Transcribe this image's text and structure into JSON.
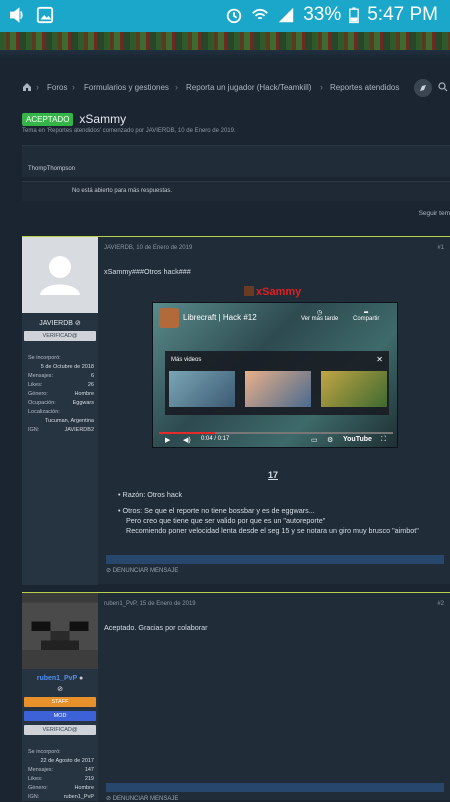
{
  "statusbar": {
    "battery": "33%",
    "time": "5:47 PM"
  },
  "colors": {
    "accent": "#1aa7c9",
    "badge": "#35b548",
    "staff": "#e8902a",
    "mod": "#3d62d8"
  },
  "breadcrumbs": [
    "Foros",
    "Formularios y gestiones",
    "Reporta un jugador (Hack/Teamkill)",
    "Reportes atendidos"
  ],
  "thread": {
    "badge": "ACEPTADO",
    "title": "xSammy",
    "meta": "Tema en 'Reportes atendidos' comenzado por JAVIERDB, 10 de Enero de 2019.",
    "participant": "ThompThompson",
    "closed": "No está abierto para más respuestas.",
    "follow": "Seguir tem"
  },
  "post1": {
    "author": "JAVIERDB",
    "verified": "VERIFICAD@",
    "date": "JAVIERDB, 10 de Enero de 2019",
    "number": "#1",
    "stats": [
      {
        "label": "Se incorporó:",
        "value": ""
      },
      {
        "label": "",
        "value": "5 de Octubre de 2018"
      },
      {
        "label": "Mensajes:",
        "value": "6"
      },
      {
        "label": "Likes:",
        "value": "26"
      },
      {
        "label": "Género:",
        "value": "Hombre"
      },
      {
        "label": "Ocupación:",
        "value": "Eggwars"
      },
      {
        "label": "Localización:",
        "value": ""
      },
      {
        "label": "",
        "value": "Tucuman, Argentina"
      },
      {
        "label": "IGN:",
        "value": "JAVIERDB2"
      }
    ],
    "line1": "xSammy###Otros hack###",
    "player": "xSammy",
    "video": {
      "title": "Librecraft | Hack #12",
      "watch_later": "Ver más tarde",
      "share": "Compartir",
      "more": "Más videos",
      "time": "0:04 / 0:17",
      "brand": "YouTube",
      "progress": 0.24
    },
    "number_link": "17",
    "reason": "Razón: Otros hack",
    "other1": "Otros: Se que el reporte no tiene bossbar y es de eggwars...",
    "other2": "Pero creo que tiene que ser valido por que es un \"autoreporte\"",
    "other3": "Recomiendo poner velocidad lenta desde el seg 15 y se notara un giro muy brusco \"aimbot\"",
    "report": "DENUNCIAR MENSAJE"
  },
  "post2": {
    "author": "ruben1_PvP",
    "staff": "STAFF",
    "mod": "MOD",
    "verified": "VERIFICAD@",
    "date": "ruben1_PvP, 15 de Enero de 2019",
    "number": "#2",
    "stats": [
      {
        "label": "Se incorporó:",
        "value": ""
      },
      {
        "label": "",
        "value": "22 de Agosto de 2017"
      },
      {
        "label": "Mensajes:",
        "value": "147"
      },
      {
        "label": "Likes:",
        "value": "219"
      },
      {
        "label": "Género:",
        "value": "Hombre"
      },
      {
        "label": "IGN:",
        "value": "ruben1_PvP"
      }
    ],
    "text": "Aceptado. Gracias por colaborar",
    "report": "DENUNCIAR MENSAJE"
  }
}
